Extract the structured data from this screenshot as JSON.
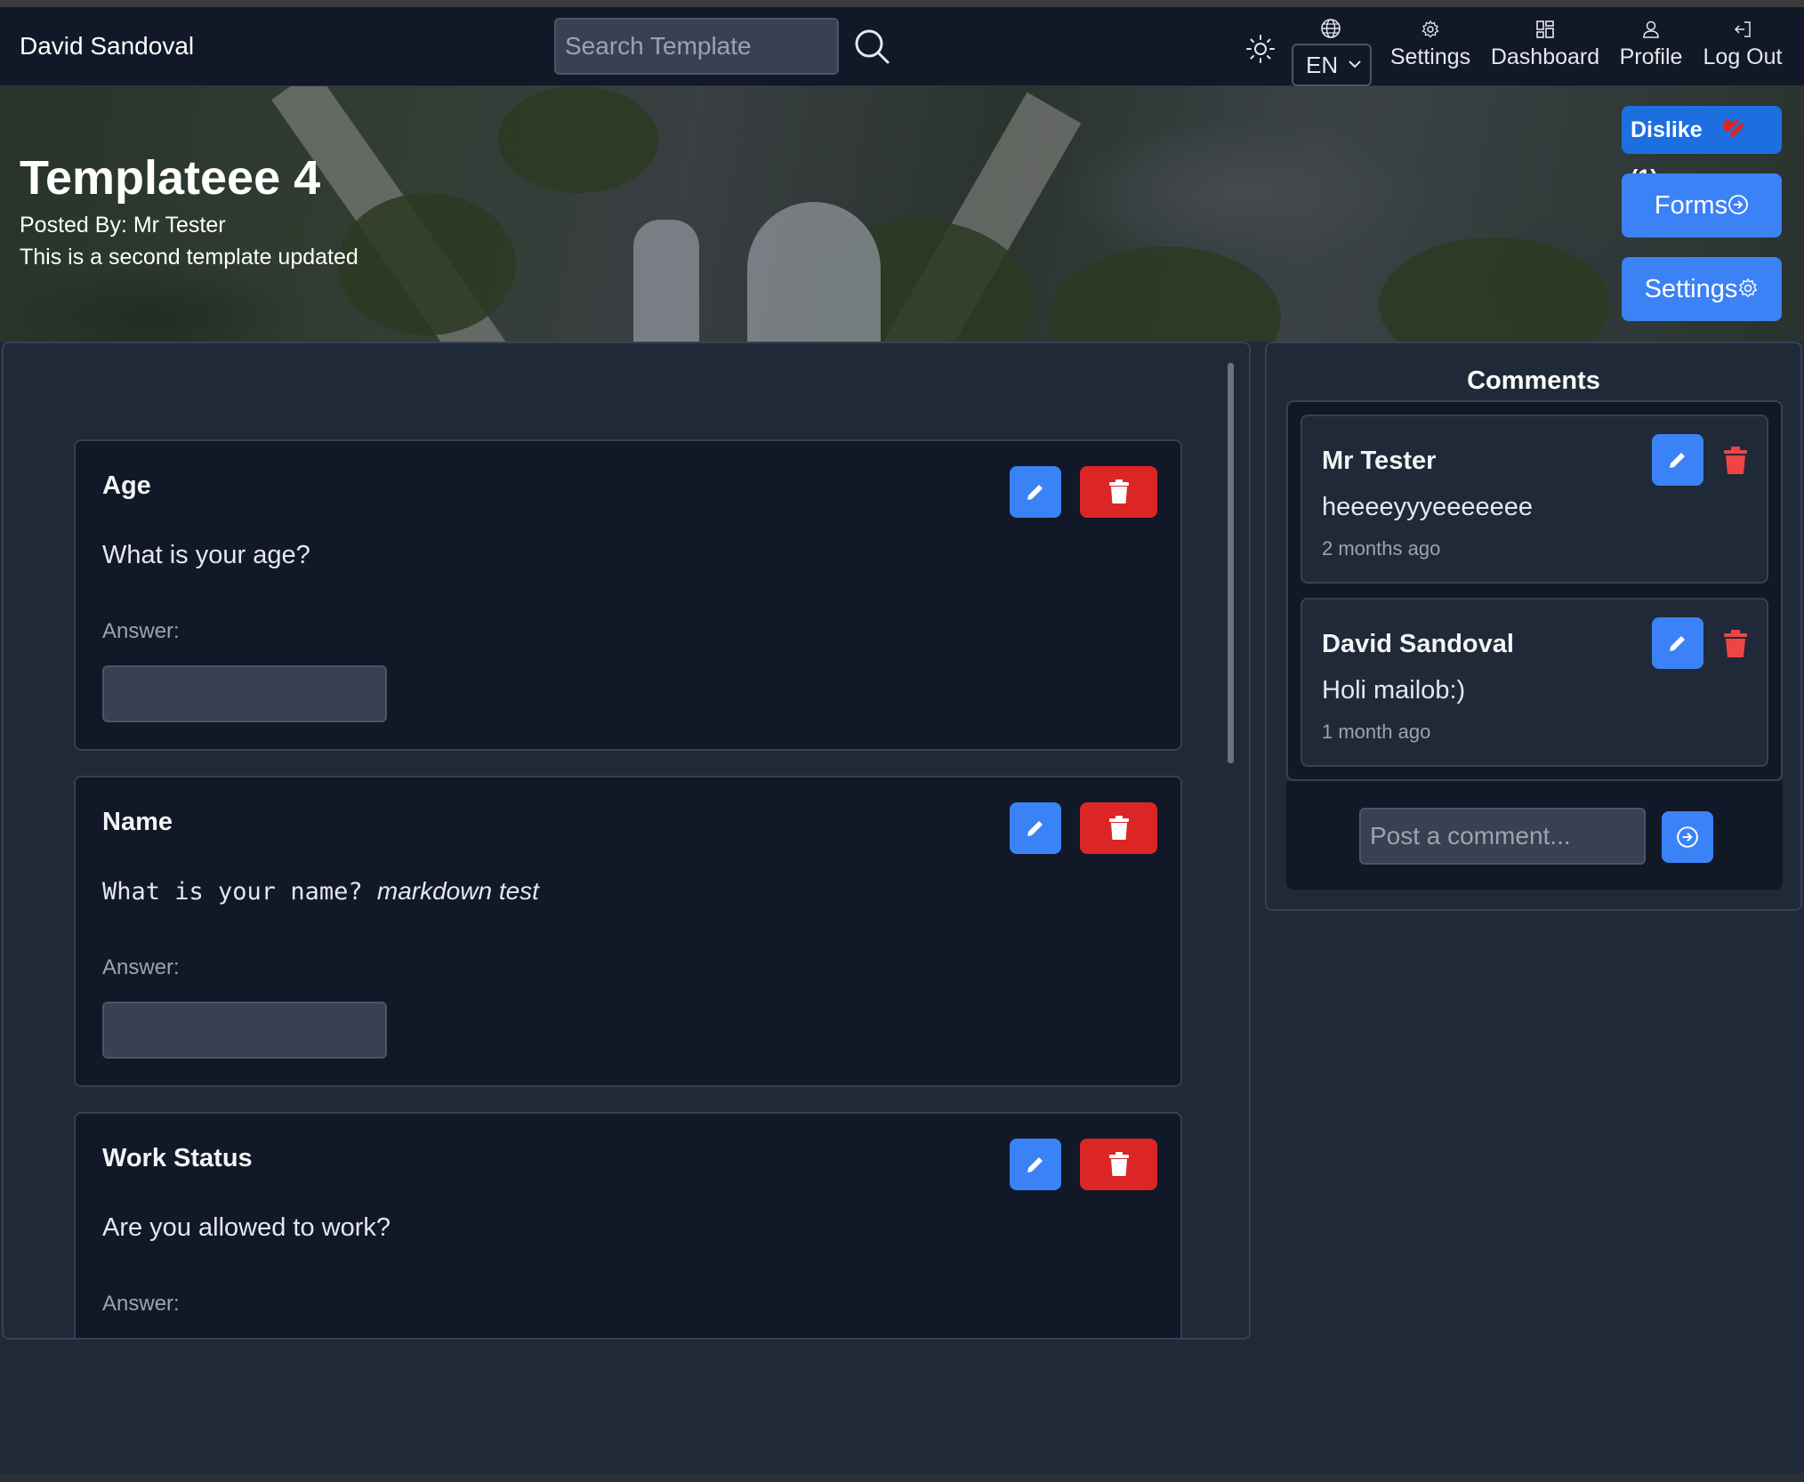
{
  "header": {
    "user_name": "David Sandoval",
    "search_placeholder": "Search Template",
    "language": "EN",
    "nav": {
      "settings": "Settings",
      "dashboard": "Dashboard",
      "profile": "Profile",
      "logout": "Log Out"
    }
  },
  "hero": {
    "title": "Templateee 4",
    "posted_by": "Posted By: Mr Tester",
    "description": "This is a second template updated",
    "dislike_label": "Dislike",
    "dislike_count": "(1)",
    "forms_label": "Forms",
    "settings_label": "Settings"
  },
  "questions": [
    {
      "title": "Age",
      "text": "What is your age?",
      "answer_label": "Answer:"
    },
    {
      "title": "Name",
      "text": "What is your name?",
      "text_emphasis": "markdown test",
      "answer_label": "Answer:"
    },
    {
      "title": "Work Status",
      "text": "Are you allowed to work?",
      "answer_label": "Answer:"
    }
  ],
  "comments": {
    "title": "Comments",
    "items": [
      {
        "author": "Mr Tester",
        "text": "heeeeyyyeeeeeee",
        "time": "2 months ago"
      },
      {
        "author": "David Sandoval",
        "text": "Holi mailob:)",
        "time": "1 month ago"
      }
    ],
    "input_placeholder": "Post a comment..."
  },
  "colors": {
    "accent": "#3b82f6",
    "danger": "#dc2626",
    "navbar_bg": "#111827",
    "panel_bg": "#1f2937"
  }
}
